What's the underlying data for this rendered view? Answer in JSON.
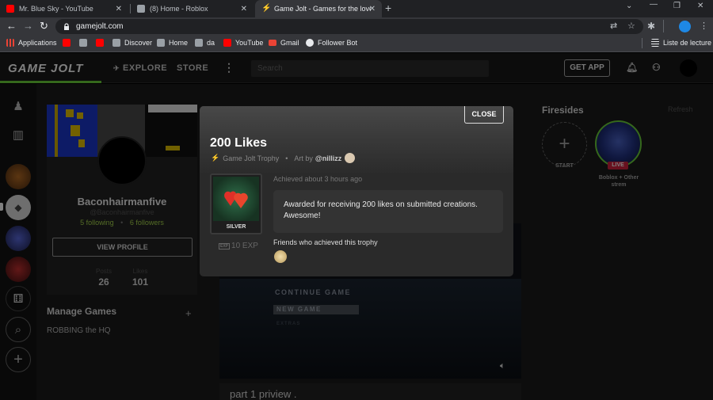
{
  "browser": {
    "tabs": [
      {
        "title": "Mr. Blue Sky - YouTube",
        "color": "#ff0000"
      },
      {
        "title": "(8) Home - Roblox",
        "color": "#9aa0a6"
      },
      {
        "title": "Game Jolt - Games for the love o",
        "color": "#ccff00"
      }
    ],
    "new_tab": "+",
    "url": "gamejolt.com",
    "bookmarks": [
      {
        "label": "Applications",
        "color": "#ea4335"
      },
      {
        "label": "",
        "color": "#ff0000"
      },
      {
        "label": "",
        "color": "#9aa0a6"
      },
      {
        "label": "",
        "color": "#ff0000"
      },
      {
        "label": "Discover",
        "color": "#9aa0a6"
      },
      {
        "label": "Home",
        "color": "#9aa0a6"
      },
      {
        "label": "da",
        "color": "#9aa0a6"
      },
      {
        "label": "YouTube",
        "color": "#ff0000"
      },
      {
        "label": "Gmail",
        "color": "#ea4335"
      },
      {
        "label": "Follower Bot",
        "color": "#e8eaed"
      }
    ],
    "reading_list": "Liste de lecture"
  },
  "gj": {
    "logo": "GAME JOLT",
    "nav": [
      "EXPLORE",
      "STORE"
    ],
    "search_placeholder": "Search",
    "get_app": "GET APP"
  },
  "profile": {
    "name": "Baconhairmanfive",
    "handle": "@Baconhairmanfive",
    "following_count": "5",
    "following_label": "following",
    "followers_count": "6",
    "followers_label": "followers",
    "view_profile": "VIEW PROFILE",
    "posts_label": "Posts",
    "posts": "26",
    "likes_label": "Likes",
    "likes": "101"
  },
  "manage_games": {
    "title": "Manage Games",
    "add": "+",
    "items": [
      "ROBBING the HQ"
    ]
  },
  "feed": {
    "video_menu": [
      "CONTINUE GAME",
      "NEW GAME",
      "EXTRAS"
    ],
    "post_title": "part 1 priview ."
  },
  "firesides": {
    "title": "Firesides",
    "refresh": "Refresh",
    "start_label": "START",
    "live_badge": "LIVE",
    "live_name": "Boblox + Other strem"
  },
  "trophy": {
    "close": "CLOSE",
    "title": "200 Likes",
    "type": "Game Jolt Trophy",
    "sep": "•",
    "art_by_label": "Art by",
    "artist": "@nillizz",
    "tier": "SILVER",
    "exp_badge": "EXP",
    "exp": "10 EXP",
    "achieved": "Achieved about 3 hours ago",
    "description": "Awarded for receiving 200 likes on submitted creations. Awesome!",
    "friends_label": "Friends who achieved this trophy"
  }
}
